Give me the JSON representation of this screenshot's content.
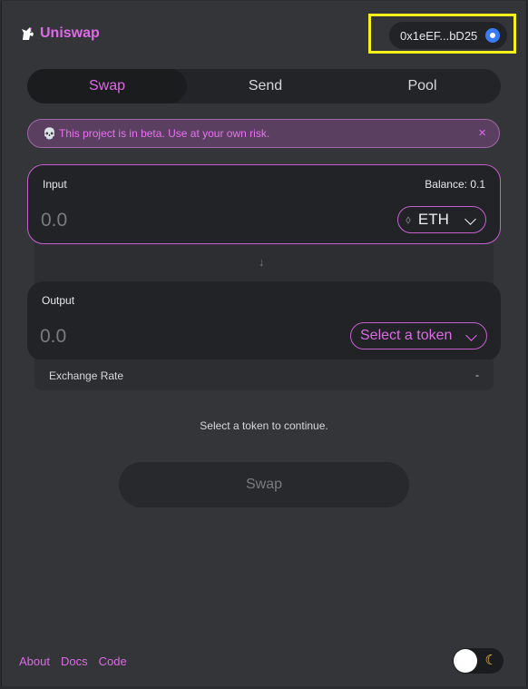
{
  "header": {
    "logo_text": "Uniswap",
    "wallet_address": "0x1eEF...bD25"
  },
  "tabs": [
    {
      "label": "Swap",
      "active": true
    },
    {
      "label": "Send",
      "active": false
    },
    {
      "label": "Pool",
      "active": false
    }
  ],
  "warning": {
    "icon": "skull-icon",
    "text": "💀 This project is in beta. Use at your own risk.",
    "close": "×"
  },
  "input": {
    "label": "Input",
    "balance": "Balance: 0.1",
    "placeholder": "0.0",
    "token": "ETH"
  },
  "output": {
    "label": "Output",
    "placeholder": "0.0",
    "token": "Select a token"
  },
  "exchange_rate": {
    "label": "Exchange Rate",
    "value": "-"
  },
  "hint": "Select a token to continue.",
  "swap_button": "Swap",
  "footer": {
    "about": "About",
    "docs": "Docs",
    "code": "Code"
  },
  "colors": {
    "accent": "#dc6be5",
    "highlight": "#f5f01b",
    "background": "#333538"
  }
}
